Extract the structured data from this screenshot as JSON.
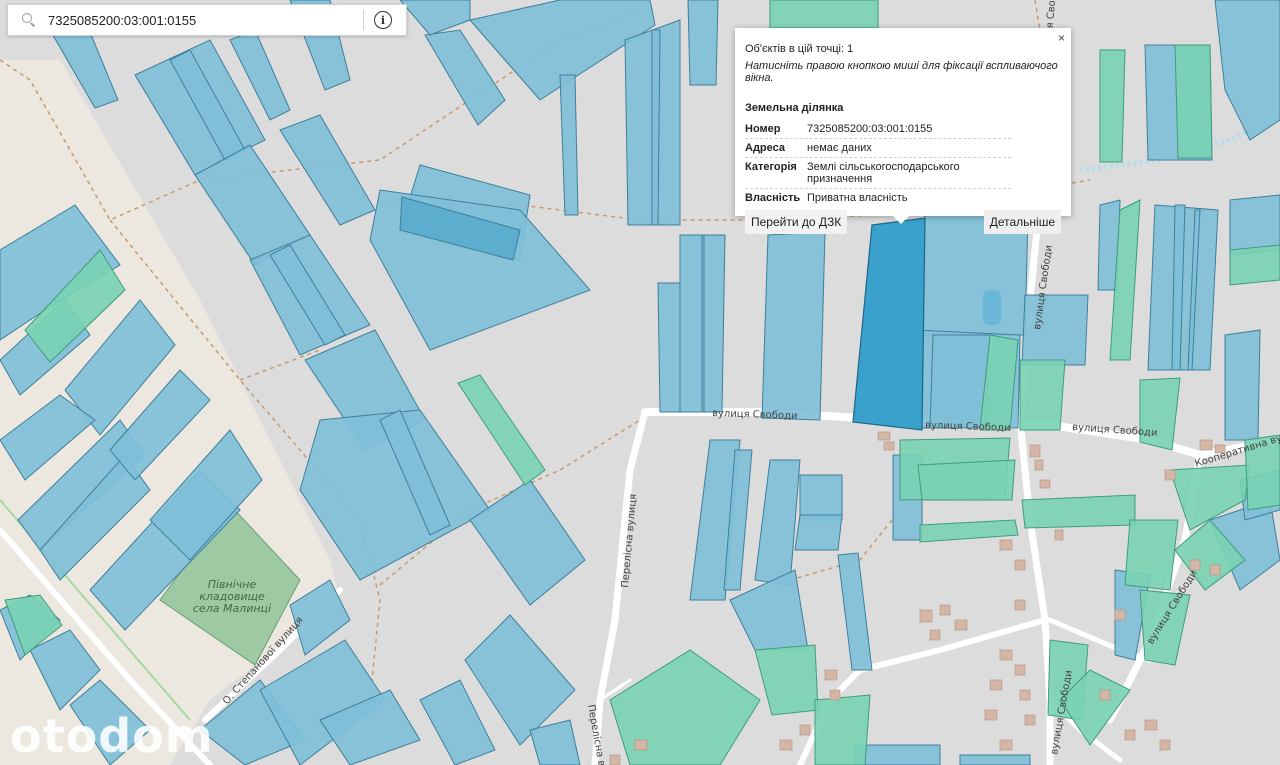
{
  "search": {
    "value": "7325085200:03:001:0155",
    "placeholder": ""
  },
  "popup": {
    "objects_count": "Об'єктів в цій точці: 1",
    "hint": "Натисніть правою кнопкою миші для фіксації вспливаючого вікна.",
    "section_title": "Земельна ділянка",
    "attributes": [
      {
        "key": "Номер",
        "value": "7325085200:03:001:0155"
      },
      {
        "key": "Адреса",
        "value": "немає даних"
      },
      {
        "key": "Категорія",
        "value": "Землі сільськогосподарського призначення"
      },
      {
        "key": "Власність",
        "value": "Приватна власність"
      }
    ],
    "goto_button": "Перейти до ДЗК",
    "details_button": "Детальніше",
    "close_symbol": "×"
  },
  "map": {
    "street_labels": [
      "вулиця Свободи",
      "вулиця Свободи",
      "вулиця Свободи",
      "вулиця Свободи",
      "вулиця Свободи",
      "Кооперативна вулиця",
      "Перелісна вулиця",
      "Перелісна вулиця",
      "О. Степанової вулиця",
      "вулиця Свободи",
      "вулиця Свободи"
    ],
    "cemetery_label_lines": [
      "Північне",
      "кладовище",
      "села Малинці"
    ],
    "colors": {
      "background": "#dcdcdc",
      "parcel_private": "#7fbfd8",
      "parcel_other": "#79d3b2",
      "parcel_selected": "#3aa0cc"
    }
  },
  "watermark": "otodom"
}
